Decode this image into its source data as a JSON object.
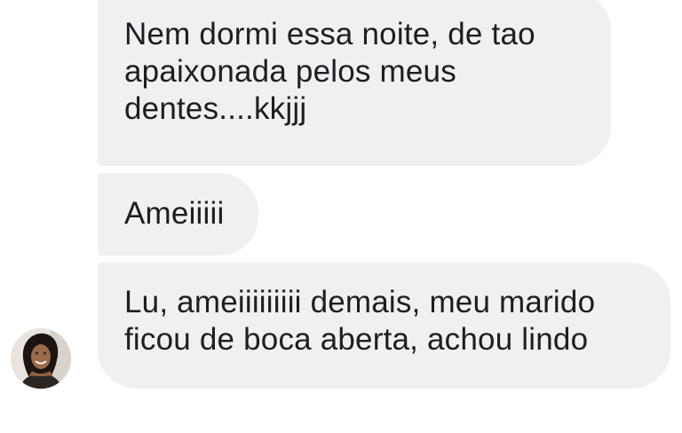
{
  "conversation": {
    "messages": [
      {
        "text": "Nem dormi essa noite, de tao\napaixonada pelos  meus\ndentes....kkjjj"
      },
      {
        "text": "Ameiiiii"
      },
      {
        "text": "Lu, ameiiiiiiiii demais, meu marido\nficou de boca aberta, achou lindo"
      }
    ],
    "sender": {
      "avatar_icon": "profile-photo"
    }
  },
  "colors": {
    "bubble_background": "#f1f0f0",
    "message_text": "#1c1e21",
    "page_background": "#ffffff"
  }
}
